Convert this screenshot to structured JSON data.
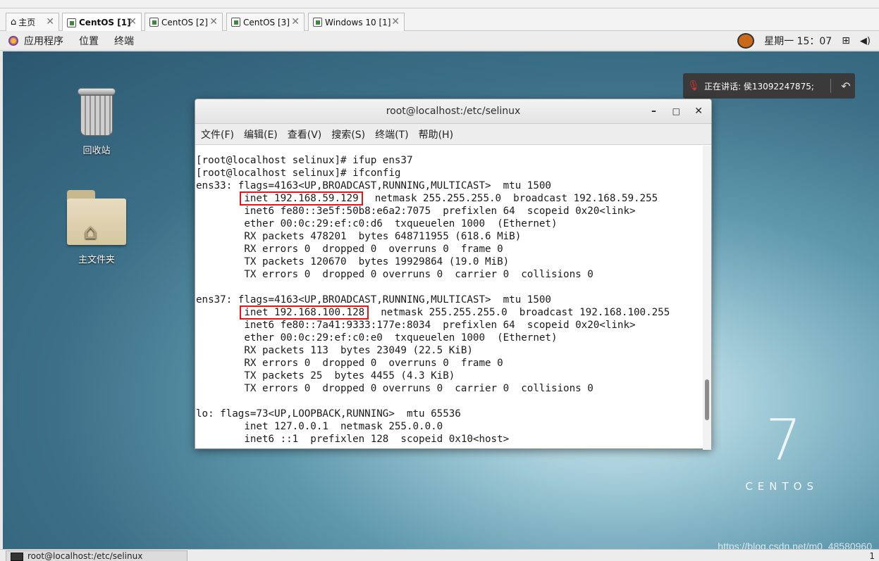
{
  "tabs": [
    {
      "label": "主页",
      "active": false
    },
    {
      "label": "CentOS [1]",
      "active": true
    },
    {
      "label": "CentOS [2]",
      "active": false
    },
    {
      "label": "CentOS [3]",
      "active": false
    },
    {
      "label": "Windows 10 [1]",
      "active": false
    }
  ],
  "tab_close_glyph": "✕",
  "gnome_panel": {
    "apps_menu": "应用程序",
    "places_menu": "位置",
    "terminal_menu": "终端",
    "clock": "星期一 15：07"
  },
  "desktop": {
    "trash_label": "回收站",
    "home_label": "主文件夹",
    "brand_number": "7",
    "brand_word": "CENTOS"
  },
  "speaking_notice": {
    "text": "正在讲话: 侯13092247875;"
  },
  "terminal": {
    "title": "root@localhost:/etc/selinux",
    "minimize": "–",
    "maximize": "□",
    "close": "✕",
    "menu": [
      "文件(F)",
      "编辑(E)",
      "查看(V)",
      "搜索(S)",
      "终端(T)",
      "帮助(H)"
    ],
    "lines": [
      "[root@localhost selinux]# ifup ens37",
      "[root@localhost selinux]# ifconfig",
      "ens33: flags=4163<UP,BROADCAST,RUNNING,MULTICAST>  mtu 1500",
      "        inet 192.168.59.129  netmask 255.255.255.0  broadcast 192.168.59.255",
      "        inet6 fe80::3e5f:50b8:e6a2:7075  prefixlen 64  scopeid 0x20<link>",
      "        ether 00:0c:29:ef:c0:d6  txqueuelen 1000  (Ethernet)",
      "        RX packets 478201  bytes 648711955 (618.6 MiB)",
      "        RX errors 0  dropped 0  overruns 0  frame 0",
      "        TX packets 120670  bytes 19929864 (19.0 MiB)",
      "        TX errors 0  dropped 0 overruns 0  carrier 0  collisions 0",
      "",
      "ens37: flags=4163<UP,BROADCAST,RUNNING,MULTICAST>  mtu 1500",
      "        inet 192.168.100.128  netmask 255.255.255.0  broadcast 192.168.100.255",
      "        inet6 fe80::7a41:9333:177e:8034  prefixlen 64  scopeid 0x20<link>",
      "        ether 00:0c:29:ef:c0:e0  txqueuelen 1000  (Ethernet)",
      "        RX packets 113  bytes 23049 (22.5 KiB)",
      "        RX errors 0  dropped 0  overruns 0  frame 0",
      "        TX packets 25  bytes 4455 (4.3 KiB)",
      "        TX errors 0  dropped 0 overruns 0  carrier 0  collisions 0",
      "",
      "lo: flags=73<UP,LOOPBACK,RUNNING>  mtu 65536",
      "        inet 127.0.0.1  netmask 255.0.0.0",
      "        inet6 ::1  prefixlen 128  scopeid 0x10<host>"
    ],
    "highlight_a": {
      "pre": "        ",
      "hl": "inet 192.168.59.129",
      "post": "  netmask 255.255.255.0  broadcast 192.168.59.255"
    },
    "highlight_b": {
      "pre": "        ",
      "hl": "inet 192.168.100.128",
      "post": "  netmask 255.255.255.0  broadcast 192.168.100.255"
    }
  },
  "taskbar": {
    "item_label": "root@localhost:/etc/selinux",
    "page": "1"
  },
  "watermark": "https://blog.csdn.net/m0_48580960"
}
